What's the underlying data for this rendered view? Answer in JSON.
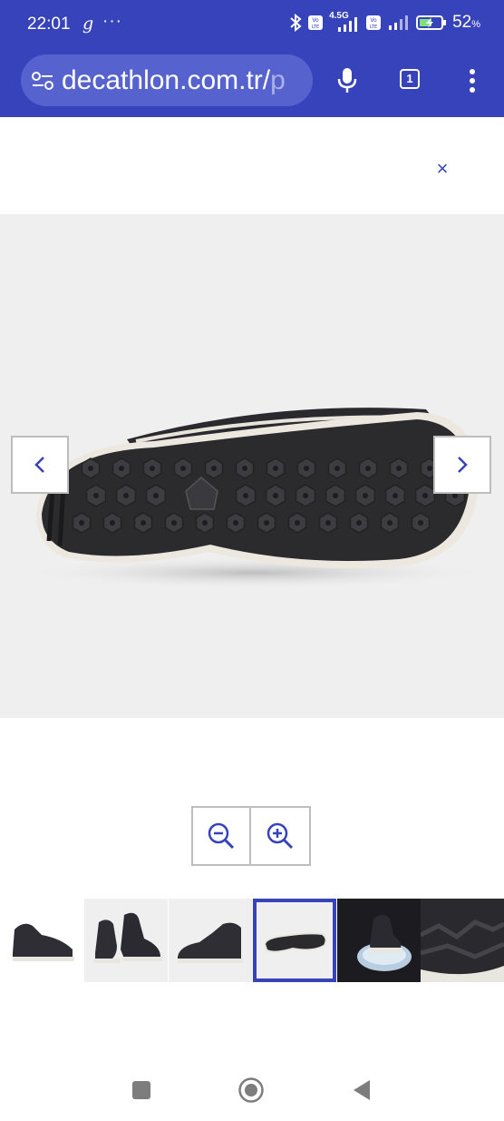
{
  "status_bar": {
    "time": "22:01",
    "g_indicator": "g",
    "more": "···",
    "network_label": "4.5G",
    "volte_1": "Vo LTE",
    "volte_2": "Vo LTE",
    "battery": "52",
    "battery_unit": "%"
  },
  "browser": {
    "url_visible": "decathlon.com.tr/",
    "url_faded": "p",
    "tab_count": "1",
    "icons": [
      "site-settings-icon",
      "mic-icon",
      "tab-switcher-icon",
      "overflow-menu-icon"
    ]
  },
  "viewer": {
    "close_label": "×",
    "prev_icon": "chevron-left-icon",
    "next_icon": "chevron-right-icon",
    "zoom_out_icon": "zoom-out-icon",
    "zoom_in_icon": "zoom-in-icon",
    "thumbnails": [
      {
        "subject": "shoe-side-left"
      },
      {
        "subject": "shoe-pair"
      },
      {
        "subject": "shoe-side-right"
      },
      {
        "subject": "shoe-sole",
        "active": true
      },
      {
        "subject": "shoe-on-ice"
      },
      {
        "subject": "shoe-closeup"
      }
    ]
  },
  "colors": {
    "brand": "#3643ba",
    "viewer_bg": "#efefef"
  },
  "navigation": {
    "icons": [
      "recents-square-icon",
      "home-circle-icon",
      "back-triangle-icon"
    ]
  }
}
